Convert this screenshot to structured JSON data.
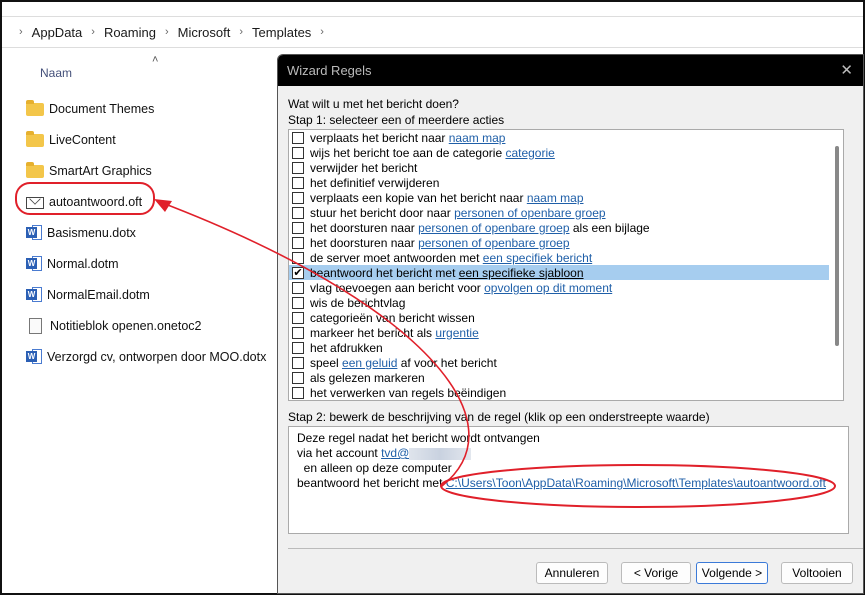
{
  "explorer": {
    "breadcrumb": [
      "AppData",
      "Roaming",
      "Microsoft",
      "Templates"
    ],
    "column_header": "Naam",
    "files": [
      {
        "name": "Document Themes",
        "icon": "folder-icon"
      },
      {
        "name": "LiveContent",
        "icon": "folder-icon"
      },
      {
        "name": "SmartArt Graphics",
        "icon": "folder-icon"
      },
      {
        "name": "autoantwoord.oft",
        "icon": "mail-template-icon"
      },
      {
        "name": "Basismenu.dotx",
        "icon": "word-template-icon"
      },
      {
        "name": "Normal.dotm",
        "icon": "word-macro-template-icon"
      },
      {
        "name": "NormalEmail.dotm",
        "icon": "word-macro-template-icon"
      },
      {
        "name": "Notitieblok openen.onetoc2",
        "icon": "file-icon"
      },
      {
        "name": "Verzorgd cv, ontworpen door MOO.dotx",
        "icon": "word-template-icon"
      }
    ]
  },
  "dialog": {
    "title": "Wizard Regels",
    "question": "Wat wilt u met het bericht doen?",
    "step1": "Stap 1: selecteer een of meerdere acties",
    "actions": [
      {
        "checked": false,
        "parts": [
          {
            "t": "verplaats het bericht naar "
          },
          {
            "t": "naam map",
            "link": true
          }
        ]
      },
      {
        "checked": false,
        "parts": [
          {
            "t": "wijs het bericht toe aan de categorie "
          },
          {
            "t": "categorie",
            "link": true
          }
        ]
      },
      {
        "checked": false,
        "parts": [
          {
            "t": "verwijder het bericht"
          }
        ]
      },
      {
        "checked": false,
        "parts": [
          {
            "t": "het definitief verwijderen"
          }
        ]
      },
      {
        "checked": false,
        "parts": [
          {
            "t": "verplaats een kopie van het bericht naar "
          },
          {
            "t": "naam map",
            "link": true
          }
        ]
      },
      {
        "checked": false,
        "parts": [
          {
            "t": "stuur het bericht door naar "
          },
          {
            "t": "personen of openbare groep",
            "link": true
          }
        ]
      },
      {
        "checked": false,
        "parts": [
          {
            "t": "het doorsturen naar "
          },
          {
            "t": "personen of openbare groep",
            "link": true
          },
          {
            "t": " als een bijlage"
          }
        ]
      },
      {
        "checked": false,
        "parts": [
          {
            "t": "het doorsturen naar "
          },
          {
            "t": "personen of openbare groep",
            "link": true
          }
        ]
      },
      {
        "checked": false,
        "parts": [
          {
            "t": "de server moet antwoorden met "
          },
          {
            "t": "een specifiek bericht",
            "link": true
          }
        ]
      },
      {
        "checked": true,
        "selected": true,
        "parts": [
          {
            "t": "beantwoord het bericht met "
          },
          {
            "t": "een specifieke sjabloon",
            "link": true
          }
        ]
      },
      {
        "checked": false,
        "parts": [
          {
            "t": "vlag toevoegen aan bericht voor "
          },
          {
            "t": "opvolgen op dit moment",
            "link": true
          }
        ]
      },
      {
        "checked": false,
        "parts": [
          {
            "t": "wis de berichtvlag"
          }
        ]
      },
      {
        "checked": false,
        "parts": [
          {
            "t": "categorieën van bericht wissen"
          }
        ]
      },
      {
        "checked": false,
        "parts": [
          {
            "t": "markeer het bericht als "
          },
          {
            "t": "urgentie",
            "link": true
          }
        ]
      },
      {
        "checked": false,
        "parts": [
          {
            "t": "het afdrukken"
          }
        ]
      },
      {
        "checked": false,
        "parts": [
          {
            "t": "speel "
          },
          {
            "t": "een geluid",
            "link": true
          },
          {
            "t": " af voor het bericht"
          }
        ]
      },
      {
        "checked": false,
        "parts": [
          {
            "t": "als gelezen markeren"
          }
        ]
      },
      {
        "checked": false,
        "parts": [
          {
            "t": "het verwerken van regels beëindigen"
          }
        ]
      }
    ],
    "step2": "Stap 2: bewerk de beschrijving van de regel (klik op een onderstreepte waarde)",
    "description": {
      "line1": "Deze regel nadat het bericht wordt ontvangen",
      "line2_prefix": "via het account ",
      "account": "tvd@",
      "line3": "  en alleen op deze computer",
      "line4_prefix": "beantwoord het bericht met ",
      "template_path": "C:\\Users\\Toon\\AppData\\Roaming\\Microsoft\\Templates\\autoantwoord.oft"
    },
    "buttons": {
      "cancel": "Annuleren",
      "back": "< Vorige",
      "next": "Volgende >",
      "finish": "Voltooien"
    }
  },
  "annotation_color": "#e0202a"
}
